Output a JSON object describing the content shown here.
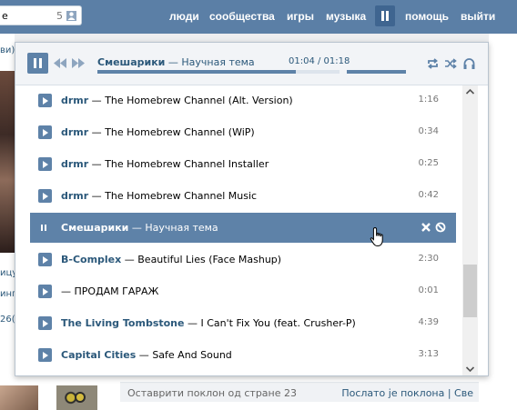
{
  "topbar": {
    "search_value": "е",
    "people_count": "5",
    "nav": [
      "люди",
      "сообщества",
      "игры",
      "музыка",
      "помощь",
      "выйти"
    ],
    "active_nav": "музыка",
    "bg_color": "#5b7fa6"
  },
  "background": {
    "left_fragments": [
      "ви)",
      "ицу",
      "инг",
      "26("
    ],
    "footer_left": "Оставрити поклон од стране 23",
    "footer_right": "Послато је поклона | Све"
  },
  "player": {
    "now_playing": {
      "artist": "Смешарики",
      "dash": " — ",
      "title": "Научная тема"
    },
    "time": "01:04 / 01:18",
    "progress_fraction": 0.82,
    "volume_fraction": 1.0,
    "icons": [
      "play-pause-icon",
      "prev-icon",
      "next-icon",
      "repeat-icon",
      "shuffle-icon",
      "headphones-icon"
    ],
    "accent": "#5e82a8",
    "tracks": [
      {
        "artist": "drmr",
        "title": "The Homebrew Channel (Alt. Version)",
        "duration": "1:16"
      },
      {
        "artist": "drmr",
        "title": "The Homebrew Channel (WiP)",
        "duration": "0:34"
      },
      {
        "artist": "drmr",
        "title": "The Homebrew Channel Installer",
        "duration": "0:25"
      },
      {
        "artist": "drmr",
        "title": "The Homebrew Channel Music",
        "duration": "0:42"
      },
      {
        "artist": "Смешарики",
        "title": "Научная тема",
        "duration": "",
        "active": true
      },
      {
        "artist": "B-Complex",
        "title": "Beautiful Lies (Face Mashup)",
        "duration": "2:30"
      },
      {
        "artist": "",
        "title": "ПРОДАМ ГАРАЖ",
        "duration": "0:01"
      },
      {
        "artist": "The Living Tombstone",
        "title": "I Can't Fix You (feat. Crusher-P)",
        "duration": "4:39"
      },
      {
        "artist": "Capital Cities",
        "title": "Safe And Sound",
        "duration": "3:13"
      }
    ]
  }
}
